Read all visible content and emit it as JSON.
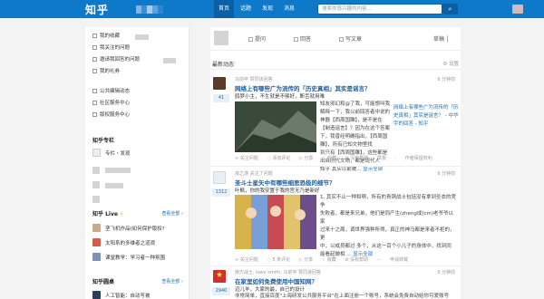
{
  "topbar": {
    "logo": "知乎",
    "nav": [
      "首页",
      "话题",
      "发现",
      "消息"
    ],
    "search_placeholder": "搜索你感兴趣的内容...",
    "search_icon": "search-icon"
  },
  "sidebar": {
    "items": [
      "我的收藏",
      "我关注的问题",
      "邀请我回答的问题",
      "我的礼券",
      "公共编辑动态",
      "社区服务中心",
      "版权服务中心"
    ],
    "column_title": "知乎专栏",
    "column_item": "专栏・发现",
    "live_title": "知乎 Live",
    "live_more": "查看全部 ›",
    "live_items": [
      "垄飞机作品(如何保护版权?",
      "太阳系的多维者之道观",
      "课堂教学：学习者一种氛围"
    ],
    "roundtable_title": "知乎圆桌",
    "roundtable_more": "查看全部 ›",
    "roundtable_item": "人工智能：自动写被"
  },
  "main": {
    "toolbar": {
      "ask": "提问",
      "answer": "回答",
      "write": "写文章",
      "drafts": "草稿 │"
    },
    "feed_title": "最新动态",
    "settings": "⚙ 设置",
    "items": [
      {
        "meta": "马前卒 赞同该回答",
        "time": "9 分钟前",
        "title": "网络上有哪些广为流传的「历史真相」其实是谣言？",
        "author": "鸥梦小主，不生就是不够好，断舌就用难",
        "votes": "41",
        "body_line1": "知友邪幻和@了我，可能想叫我解释一下，我以前回答者中说的",
        "body_line2": "神器【西周国雕】，是不是在【制造谣言】？因为在这个答案",
        "body_line3": "下，我曾经明确指出，【西周国雕】，所有已知文物里找",
        "body_line4": "到只有【西周国雕】，这些都是出自历代文物，都是现代人",
        "body_line5": "知乎 其实以前被...",
        "show_all": "显示全部",
        "side_box_1": "网络上有哪些广为流传的「历史真相」其实是谣言？ - 中华宇的回答 - 知乎",
        "actions": [
          "+ 关注问题",
          "◌ 添加评论",
          "▷ 分享",
          "☆ 收藏",
          "⊘ 没有帮助",
          "举报",
          "·",
          "作者保留权利"
        ]
      },
      {
        "meta": "孩之游 关注了问题",
        "time": "9 分钟前",
        "title": "圣斗士星矢中有哪些细思恐极的细节？",
        "author": "叶枫，你的我安置于我的宫无乃是新好",
        "votes": "1312",
        "body_line1": "1. 其实不止一种和啊，所有的青铜战士包括没有拿到圣衣的竞争",
        "body_line2": "失败者，都是来兄弟，他们是同产生(zheng成)cm)老爷爷以家",
        "body_line3": "过来十之周，调世界强种所得，真正的神马都是来者不拒的，更",
        "body_line4": "中，以成员都过 多个，从这一百个小儿子的身体中，找到同",
        "body_line5": "能看起做相 ... ",
        "show_all": "显示全部",
        "actions": [
          "+ 关注问题",
          "◌ 5 条评论",
          "▷ 分享",
          "☆ 收藏",
          "⊘ 没有帮助",
          "··· ",
          "申请转载"
        ]
      },
      {
        "meta": "南方战士, lowy smith, 马前卒 赞同该回答",
        "time": "9 分钟前",
        "title": "在家里如何免费使用中国知网？",
        "author": "迈儿羊，大家的最，自己的设计",
        "votes": "2940",
        "body_line1": "非常简单，直接百度\"上海研发公共服务平台\"在上面注册一个账号，系统会免费自动给你可爱账号",
        "show_all": "显示全部"
      }
    ]
  },
  "colors": {
    "topbar": "#0e78c9",
    "link": "#1d5c9c",
    "accent": "#1a6fb6"
  }
}
